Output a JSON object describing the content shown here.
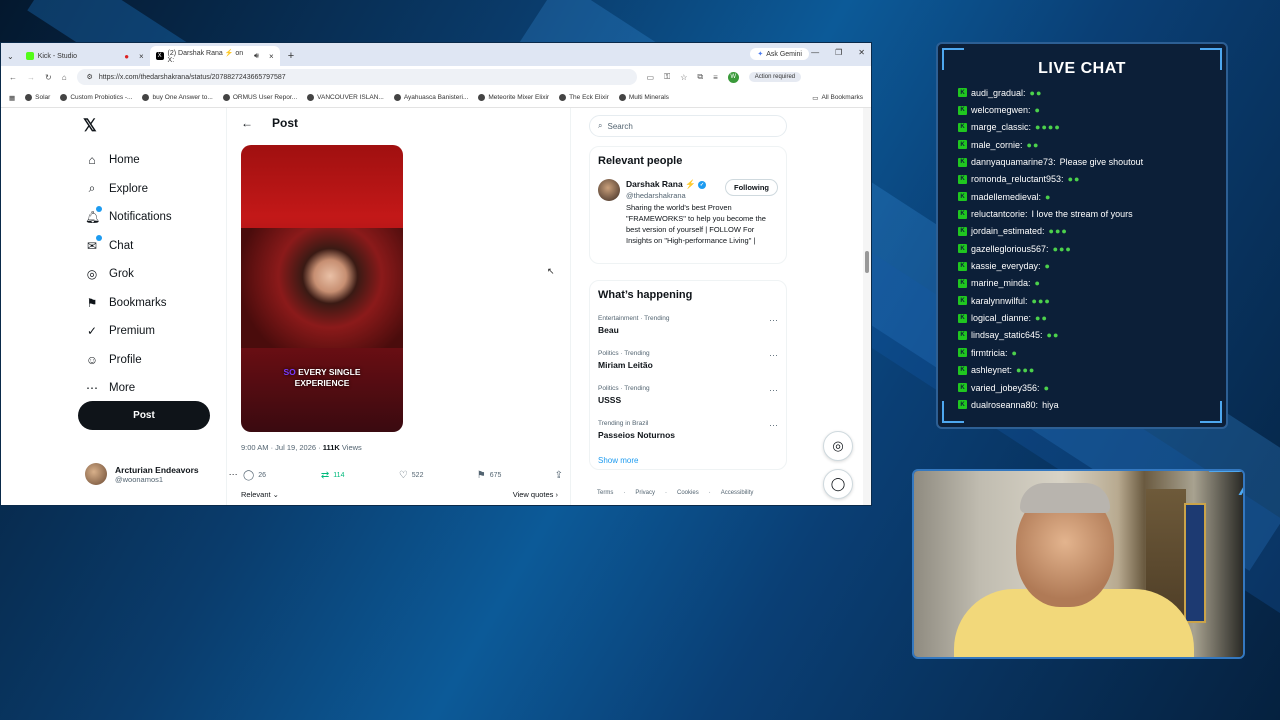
{
  "browser": {
    "tabs": [
      {
        "title": "Kick - Studio",
        "color": "#53fc18",
        "active": false
      },
      {
        "title": "(2) Darshak Rana ⚡ on X:",
        "color": "#000000",
        "active": true
      }
    ],
    "ask_gemini": "Ask Gemini",
    "url": "https://x.com/thedarshakrana/status/2078827243665797587",
    "action_required": "Action required",
    "profile_initial": "W",
    "bookmarks": [
      "Solar",
      "Custom Probiotics -...",
      "buy One Answer to...",
      "ORMUS User Repor...",
      "VANCOUVER ISLAN...",
      "Ayahuasca Banisteri...",
      "Meteorite Mixer Elixir",
      "The Eck Elixir",
      "Multi Minerals"
    ],
    "all_bookmarks": "All Bookmarks"
  },
  "nav": {
    "items": [
      {
        "label": "Home",
        "icon": "home-icon",
        "glyph": "⌂"
      },
      {
        "label": "Explore",
        "icon": "search-icon",
        "glyph": "⌕"
      },
      {
        "label": "Notifications",
        "icon": "bell-icon",
        "glyph": "🔔︎"
      },
      {
        "label": "Chat",
        "icon": "chat-icon",
        "glyph": "✉"
      },
      {
        "label": "Grok",
        "icon": "grok-icon",
        "glyph": "◎"
      },
      {
        "label": "Bookmarks",
        "icon": "bookmark-icon",
        "glyph": "⚑"
      },
      {
        "label": "Premium",
        "icon": "premium-icon",
        "glyph": "✓"
      },
      {
        "label": "Profile",
        "icon": "profile-icon",
        "glyph": "☺"
      },
      {
        "label": "More",
        "icon": "more-icon",
        "glyph": "⋯"
      }
    ],
    "post_button": "Post",
    "account": {
      "name": "Arcturian Endeavors",
      "handle": "@woonamos1"
    }
  },
  "post": {
    "header": "Post",
    "caption_highlight": "SO",
    "caption_rest_line1": "EVERY SINGLE",
    "caption_line2": "EXPERIENCE",
    "time": "9:00 AM · Jul 19, 2026 · ",
    "views_count": "111K",
    "views_label": " Views",
    "replies": "26",
    "reposts": "114",
    "likes": "522",
    "bookmarks": "675",
    "sort": "Relevant ⌄",
    "view_quotes": "View quotes ›"
  },
  "sidebar": {
    "search_placeholder": "Search",
    "relevant_people_title": "Relevant people",
    "person": {
      "name": "Darshak Rana ⚡",
      "handle": "@thedarshakrana",
      "follow": "Following",
      "bio": "Sharing the world's best Proven \"FRAMEWORKS\" to help you become the best version of yourself | FOLLOW For Insights on \"High-performance Living\" |"
    },
    "happening_title": "What’s happening",
    "trends": [
      {
        "context": "Entertainment · Trending",
        "title": "Beau"
      },
      {
        "context": "Politics · Trending",
        "title": "Miriam Leitão"
      },
      {
        "context": "Politics · Trending",
        "title": "USSS"
      },
      {
        "context": "Trending in Brazil",
        "title": "Passeios Noturnos"
      }
    ],
    "show_more": "Show more",
    "footer": [
      "Terms",
      "Privacy",
      "Cookies",
      "Accessibility",
      "·"
    ]
  },
  "chat": {
    "title": "LIVE CHAT",
    "messages": [
      {
        "user": "audi_gradual:",
        "text": "",
        "emotes": "●●"
      },
      {
        "user": "welcomegwen:",
        "text": "",
        "emotes": "●"
      },
      {
        "user": "marge_classic:",
        "text": "",
        "emotes": "●●●●"
      },
      {
        "user": "male_cornie:",
        "text": "",
        "emotes": "●●"
      },
      {
        "user": "dannyaquamarine73:",
        "text": "Please give shoutout",
        "emotes": ""
      },
      {
        "user": "romonda_reluctant953:",
        "text": "",
        "emotes": "●●"
      },
      {
        "user": "madellemedieval:",
        "text": "",
        "emotes": "●"
      },
      {
        "user": "reluctantcorie:",
        "text": "I love the stream of yours",
        "emotes": ""
      },
      {
        "user": "jordain_estimated:",
        "text": "",
        "emotes": "●●●"
      },
      {
        "user": "gazelleglorious567:",
        "text": "",
        "emotes": "●●●"
      },
      {
        "user": "kassie_everyday:",
        "text": "",
        "emotes": "●"
      },
      {
        "user": "marine_minda:",
        "text": "",
        "emotes": "●"
      },
      {
        "user": "karalynnwilful:",
        "text": "",
        "emotes": "●●●"
      },
      {
        "user": "logical_dianne:",
        "text": "",
        "emotes": "●●"
      },
      {
        "user": "lindsay_static645:",
        "text": "",
        "emotes": "●●"
      },
      {
        "user": "firmtricia:",
        "text": "",
        "emotes": "●"
      },
      {
        "user": "ashleynet:",
        "text": "",
        "emotes": "●●●"
      },
      {
        "user": "varied_jobey356:",
        "text": "",
        "emotes": "●"
      },
      {
        "user": "dualroseanna80:",
        "text": "hiya",
        "emotes": ""
      }
    ]
  },
  "colors": {
    "accent": "#1d9bf0",
    "repost": "#00ba7c",
    "kick_green": "#20c720",
    "chat_bg": "#0c1f38"
  }
}
